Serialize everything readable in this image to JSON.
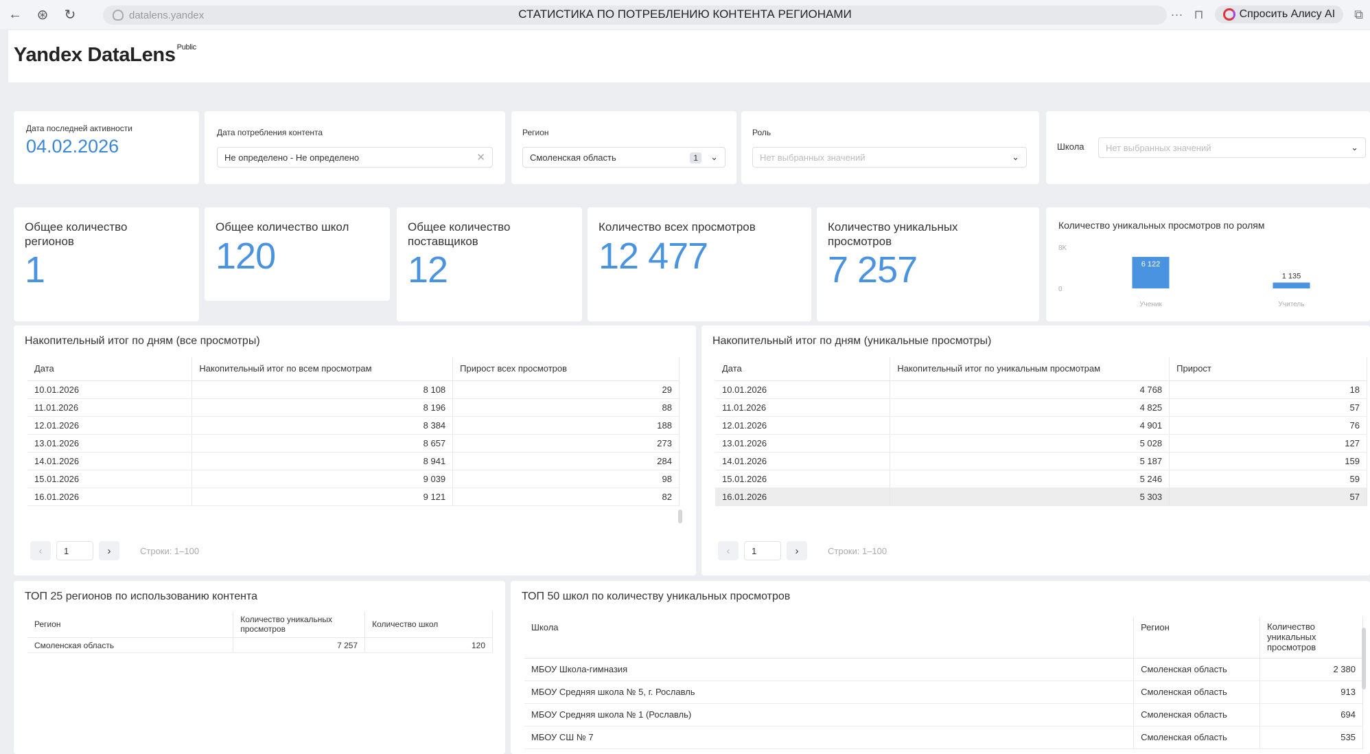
{
  "browser": {
    "url": "datalens.yandex",
    "title": "СТАТИСТИКА ПО ПОТРЕБЛЕНИЮ КОНТЕНТА РЕГИОНАМИ",
    "alice_label": "Спросить Алису AI"
  },
  "header": {
    "logo": "Yandex DataLens",
    "badge": "Public"
  },
  "filters": {
    "last_activity": {
      "label": "Дата последней активности",
      "value": "04.02.2026"
    },
    "consumption_date": {
      "label": "Дата потребления контента",
      "value": "Не определено - Не определено"
    },
    "region": {
      "label": "Регион",
      "value": "Смоленская область",
      "count": "1"
    },
    "role": {
      "label": "Роль",
      "placeholder": "Нет выбранных значений"
    },
    "school": {
      "label": "Школа",
      "placeholder": "Нет выбранных значений"
    }
  },
  "kpis": [
    {
      "title": "Общее количество регионов",
      "value": "1"
    },
    {
      "title": "Общее количество школ",
      "value": "120"
    },
    {
      "title": "Общее количество поставщиков",
      "value": "12"
    },
    {
      "title": "Количество всех просмотров",
      "value": "12 477"
    },
    {
      "title": "Количество уникальных просмотров",
      "value": "7 257"
    }
  ],
  "chart_data": {
    "type": "bar",
    "title": "Количество уникальных просмотров по ролям",
    "categories": [
      "Ученик",
      "Учитель"
    ],
    "values": [
      6122,
      1135
    ],
    "data_labels": [
      "6 122",
      "1 135"
    ],
    "y_ticks": [
      "0",
      "8K"
    ],
    "ylim": [
      0,
      8000
    ],
    "color": "#4a93e0"
  },
  "table_all": {
    "title": "Накопительный итог по дням (все просмотры)",
    "columns": [
      "Дата",
      "Накопительный итог по всем просмотрам",
      "Прирост всех просмотров"
    ],
    "rows": [
      [
        "10.01.2026",
        "8 108",
        "29"
      ],
      [
        "11.01.2026",
        "8 196",
        "88"
      ],
      [
        "12.01.2026",
        "8 384",
        "188"
      ],
      [
        "13.01.2026",
        "8 657",
        "273"
      ],
      [
        "14.01.2026",
        "8 941",
        "284"
      ],
      [
        "15.01.2026",
        "9 039",
        "98"
      ],
      [
        "16.01.2026",
        "9 121",
        "82"
      ]
    ],
    "page": "1",
    "rows_info": "Строки: 1–100"
  },
  "table_unique": {
    "title": "Накопительный итог по дням (уникальные просмотры)",
    "columns": [
      "Дата",
      "Накопительный итог по уникальным просмотрам",
      "Прирост"
    ],
    "rows": [
      [
        "10.01.2026",
        "4 768",
        "18"
      ],
      [
        "11.01.2026",
        "4 825",
        "57"
      ],
      [
        "12.01.2026",
        "4 901",
        "76"
      ],
      [
        "13.01.2026",
        "5 028",
        "127"
      ],
      [
        "14.01.2026",
        "5 187",
        "159"
      ],
      [
        "15.01.2026",
        "5 246",
        "59"
      ],
      [
        "16.01.2026",
        "5 303",
        "57"
      ]
    ],
    "page": "1",
    "rows_info": "Строки: 1–100"
  },
  "top_regions": {
    "title": "ТОП 25 регионов по использованию контента",
    "columns": [
      "Регион",
      "Количество уникальных просмотров",
      "Количество школ"
    ],
    "rows": [
      [
        "Смоленская область",
        "7 257",
        "120"
      ]
    ]
  },
  "top_schools": {
    "title": "ТОП 50 школ по количеству уникальных просмотров",
    "columns": [
      "Школа",
      "Регион",
      "Количество уникальных просмотров"
    ],
    "rows": [
      [
        "МБОУ Школа-гимназия",
        "Смоленская область",
        "2 380"
      ],
      [
        "МБОУ Средняя школа № 5, г. Рославль",
        "Смоленская область",
        "913"
      ],
      [
        "МБОУ Средняя школа № 1 (Рославль)",
        "Смоленская область",
        "694"
      ],
      [
        "МБОУ СШ № 7",
        "Смоленская область",
        "535"
      ]
    ]
  }
}
